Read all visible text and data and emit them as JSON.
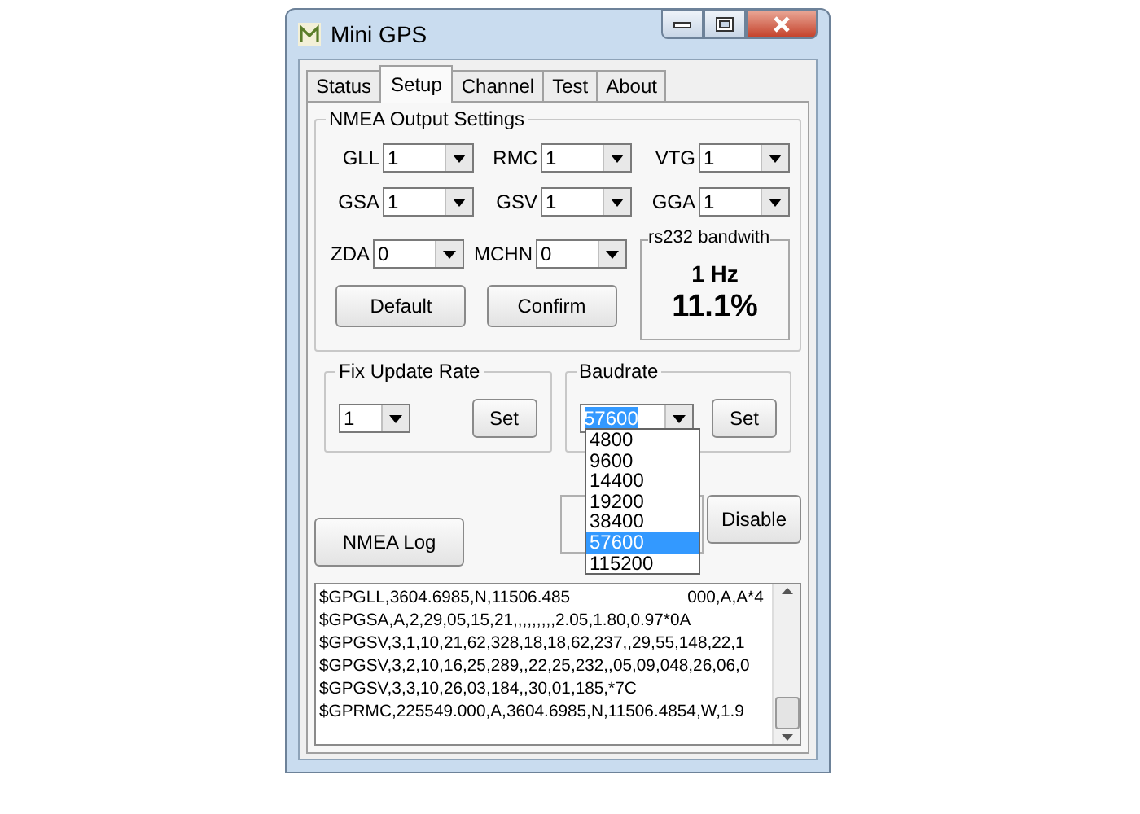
{
  "window": {
    "title": "Mini GPS"
  },
  "tabs": [
    {
      "label": "Status",
      "selected": false
    },
    {
      "label": "Setup",
      "selected": true
    },
    {
      "label": "Channel",
      "selected": false
    },
    {
      "label": "Test",
      "selected": false
    },
    {
      "label": "About",
      "selected": false
    }
  ],
  "nmea_output": {
    "title": "NMEA Output Settings",
    "fields": [
      {
        "label": "GLL",
        "value": "1"
      },
      {
        "label": "RMC",
        "value": "1"
      },
      {
        "label": "VTG",
        "value": "1"
      },
      {
        "label": "GSA",
        "value": "1"
      },
      {
        "label": "GSV",
        "value": "1"
      },
      {
        "label": "GGA",
        "value": "1"
      },
      {
        "label": "ZDA",
        "value": "0"
      },
      {
        "label": "MCHN",
        "value": "0"
      }
    ],
    "buttons": [
      "Default",
      "Confirm"
    ],
    "bandwidth": {
      "title": "rs232 bandwith",
      "rate": "1 Hz",
      "usage": "11.1%"
    }
  },
  "fix_update_rate": {
    "title": "Fix Update Rate",
    "value": "1",
    "button": "Set"
  },
  "baudrate": {
    "title": "Baudrate",
    "value": "57600",
    "button": "Set",
    "options": [
      {
        "label": "4800",
        "selected": false
      },
      {
        "label": "9600",
        "selected": false
      },
      {
        "label": "14400",
        "selected": false
      },
      {
        "label": "19200",
        "selected": false
      },
      {
        "label": "38400",
        "selected": false
      },
      {
        "label": "57600",
        "selected": true
      },
      {
        "label": "115200",
        "selected": false
      }
    ]
  },
  "nmea_log_button": "NMEA Log",
  "disable_button": "Disable",
  "log": {
    "lines": [
      {
        "segments": [
          "$GPGLL,3604.6985,N,11506.485",
          "000,A,A*4"
        ]
      },
      {
        "segments": [
          "$GPGSA,A,2,29,05,15,21,,,,,,,,,2.05,1.80,0.97*0A"
        ]
      },
      {
        "segments": [
          "$GPGSV,3,1,10,21,62,328,18,18,62,237,,29,55,148,22,1"
        ]
      },
      {
        "segments": [
          "$GPGSV,3,2,10,16,25,289,,22,25,232,,05,09,048,26,06,0"
        ]
      },
      {
        "segments": [
          "$GPGSV,3,3,10,26,03,184,,30,01,185,*7C"
        ]
      },
      {
        "segments": [
          "$GPRMC,225549.000,A,3604.6985,N,11506.4854,W,1.9"
        ]
      }
    ]
  }
}
